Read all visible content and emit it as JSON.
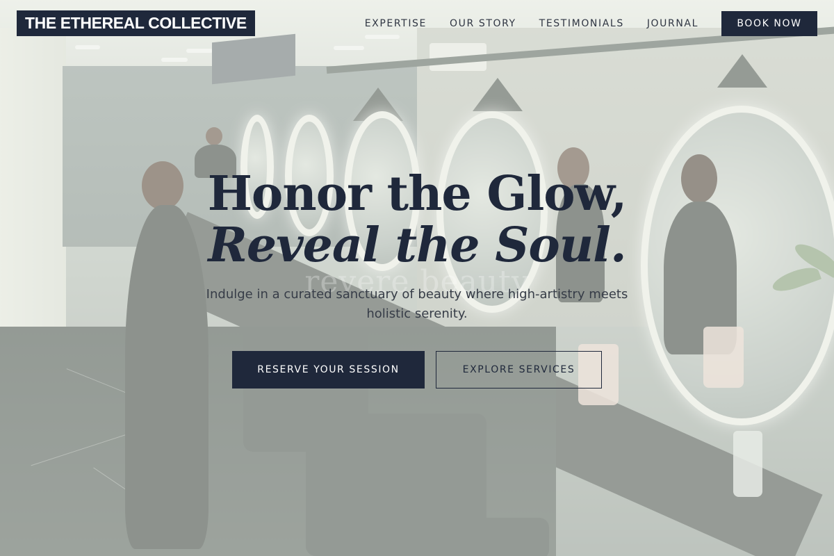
{
  "header": {
    "logo": "THE ETHEREAL COLLECTIVE",
    "nav": [
      {
        "label": "EXPERTISE"
      },
      {
        "label": "OUR STORY"
      },
      {
        "label": "TESTIMONIALS"
      },
      {
        "label": "JOURNAL"
      }
    ],
    "book_label": "BOOK NOW"
  },
  "hero": {
    "headline_line1": "Honor the Glow,",
    "headline_line2": "Reveal the Soul.",
    "subtitle": "Indulge in a curated sanctuary of beauty where high-artistry meets holistic serenity.",
    "background_text": "revere beauty",
    "primary_cta": "RESERVE YOUR SESSION",
    "secondary_cta": "EXPLORE SERVICES"
  },
  "colors": {
    "brand_navy": "#1f283b",
    "overlay": "#e8ece4",
    "text_muted": "#363c47"
  },
  "background": {
    "icon": "salon-interior-photo"
  }
}
